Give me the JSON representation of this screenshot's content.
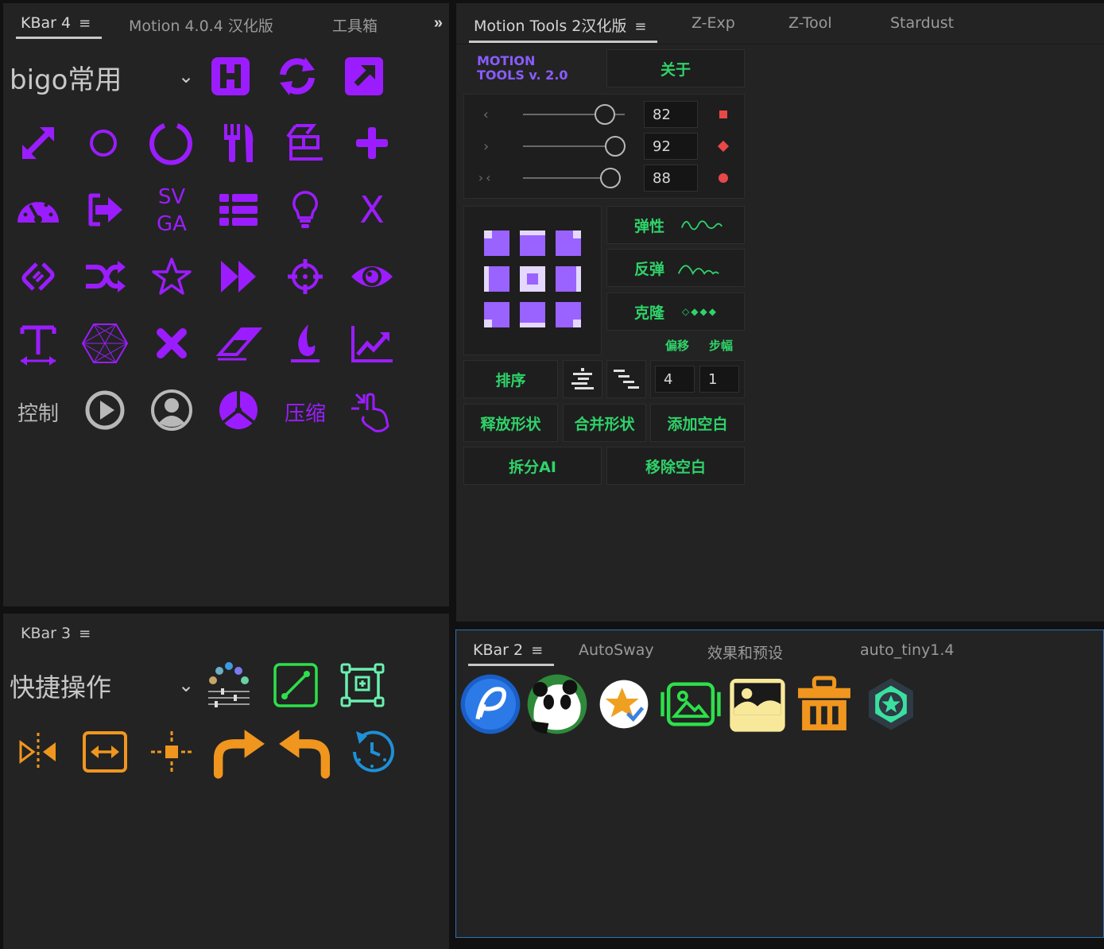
{
  "kbar4": {
    "tabs": [
      {
        "label": "KBar 4",
        "active": true
      },
      {
        "label": "Motion 4.0.4 汉化版",
        "active": false
      },
      {
        "label": "工具箱",
        "active": false
      }
    ],
    "menu_glyph": "≡",
    "overflow_glyph": "»",
    "dropdown_value": "bigo常用",
    "caret": "⌄",
    "text_icons": {
      "svga_line1": "SV",
      "svga_line2": "GA",
      "x_label": "X",
      "control_label": "控制",
      "compress_label": "压缩"
    }
  },
  "kbar3": {
    "tab": "KBar 3",
    "menu_glyph": "≡",
    "dropdown_value": "快捷操作",
    "caret": "⌄"
  },
  "motion_tools": {
    "tabs": [
      {
        "label": "Motion Tools 2汉化版",
        "active": true
      },
      {
        "label": "Z-Exp",
        "active": false
      },
      {
        "label": "Z-Tool",
        "active": false
      },
      {
        "label": "Stardust",
        "active": false
      }
    ],
    "menu_glyph": "≡",
    "logo_line1": "MOTION",
    "logo_line2": "TOOLS v. 2.0",
    "about_label": "关于",
    "sliders": [
      {
        "icon": "‹",
        "value": "82"
      },
      {
        "icon": "›",
        "value": "92"
      },
      {
        "icon": "›‹",
        "value": "88"
      }
    ],
    "elastic_label": "弹性",
    "bounce_label": "反弹",
    "clone_label": "克隆",
    "offset_label": "偏移",
    "step_label": "步幅",
    "sort_label": "排序",
    "offset_value": "4",
    "step_value": "1",
    "release_shape_label": "释放形状",
    "merge_shape_label": "合并形状",
    "add_null_label": "添加空白",
    "split_ai_label": "拆分AI",
    "remove_null_label": "移除空白",
    "colors": {
      "accent_green": "#2fd36a",
      "marker_red": "#e84848",
      "grid_purple": "#9a62ff"
    }
  },
  "kbar2": {
    "tabs": [
      {
        "label": "KBar 2",
        "active": true
      },
      {
        "label": "AutoSway",
        "active": false
      },
      {
        "label": "效果和预设",
        "active": false
      },
      {
        "label": "auto_tiny1.4",
        "active": false
      }
    ],
    "menu_glyph": "≡"
  },
  "icon_colors": {
    "purple": "#9b1dff",
    "orange": "#f0961e",
    "gray": "#b8b8b8"
  }
}
